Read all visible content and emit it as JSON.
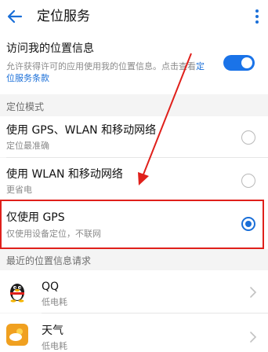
{
  "header": {
    "title": "定位服务"
  },
  "access": {
    "title": "访问我的位置信息",
    "desc_prefix": "允许获得许可的应用使用我的位置信息。点击查看",
    "desc_link": "定位服务条款",
    "enabled": true
  },
  "mode": {
    "section_label": "定位模式",
    "options": [
      {
        "title": "使用 GPS、WLAN 和移动网络",
        "subtitle": "定位最准确",
        "selected": false
      },
      {
        "title": "使用 WLAN 和移动网络",
        "subtitle": "更省电",
        "selected": false
      },
      {
        "title": "仅使用 GPS",
        "subtitle": "仅使用设备定位，不联网",
        "selected": true
      }
    ]
  },
  "recent": {
    "section_label": "最近的位置信息请求",
    "apps": [
      {
        "name": "QQ",
        "subtitle": "低电耗",
        "icon": "qq-penguin-icon"
      },
      {
        "name": "天气",
        "subtitle": "低电耗",
        "icon": "weather-icon"
      }
    ]
  },
  "colors": {
    "accent": "#1a73e8",
    "annotation_red": "#e0201b"
  }
}
